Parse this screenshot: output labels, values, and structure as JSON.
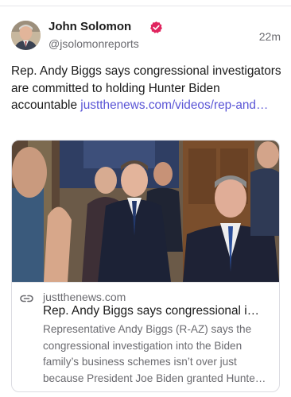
{
  "post": {
    "author_name": "John Solomon",
    "handle": "@jsolomonreports",
    "time_ago": "22m",
    "text": "Rep. Andy Biggs says congressional investigators are committed to holding Hunter Biden accountable ",
    "link_text": "justthenews.com/videos/rep-and…"
  },
  "card": {
    "domain": "justthenews.com",
    "title": "Rep. Andy Biggs says congressional i…",
    "description": "Representative Andy Biggs (R-AZ) says the congressional investigation into the Biden family’s business schemes isn’t over just because President Joe Biden granted Hunte…"
  },
  "icons": {
    "verified": "verified-badge-icon",
    "link": "link-icon"
  },
  "colors": {
    "link": "#5a55d6",
    "verified": "#e0245e",
    "secondary_text": "#6b6b70"
  }
}
